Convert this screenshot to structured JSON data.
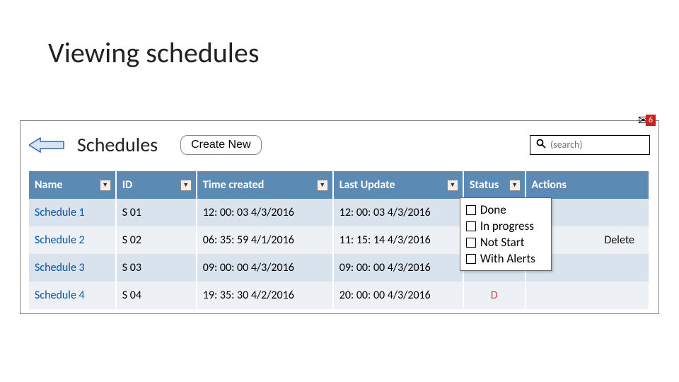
{
  "page": {
    "title": "Viewing schedules"
  },
  "header": {
    "panel_title": "Schedules",
    "create_new": "Create New",
    "search_placeholder": "(search)",
    "notif_count": "6"
  },
  "columns": {
    "name": "Name",
    "id": "ID",
    "time_created": "Time created",
    "last_update": "Last Update",
    "status": "Status",
    "actions": "Actions"
  },
  "status_filter": {
    "done": "Done",
    "in_progress": "In progress",
    "not_start": "Not Start",
    "with_alerts": "With Alerts"
  },
  "rows": [
    {
      "name": "Schedule 1",
      "id": "S 01",
      "time_created": "12: 00: 03 4/3/2016",
      "last_update": "12: 00: 03 4/3/2016",
      "status": "",
      "action": ""
    },
    {
      "name": "Schedule 2",
      "id": "S 02",
      "time_created": "06: 35: 59 4/1/2016",
      "last_update": "11: 15: 14 4/3/2016",
      "status": "",
      "action": "Delete"
    },
    {
      "name": "Schedule 3",
      "id": "S 03",
      "time_created": "09: 00: 00 4/3/2016",
      "last_update": "09: 00: 00 4/3/2016",
      "status": "",
      "action": "",
      "status_class": "p"
    },
    {
      "name": "Schedule 4",
      "id": "S 04",
      "time_created": "19: 35: 30 4/2/2016",
      "last_update": "20: 00: 00 4/3/2016",
      "status": "D",
      "action": "",
      "status_class": "d"
    }
  ]
}
